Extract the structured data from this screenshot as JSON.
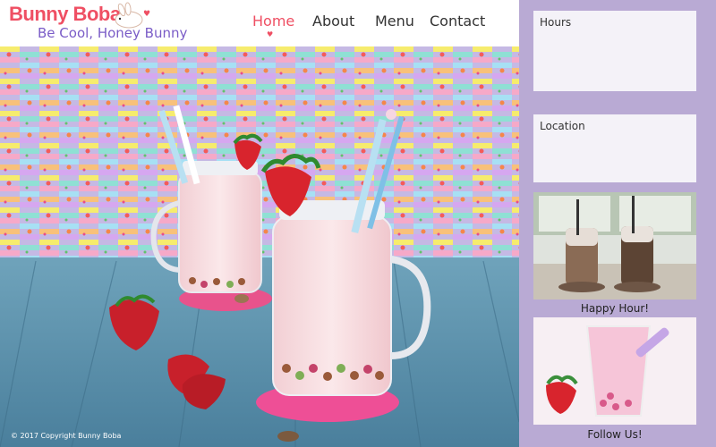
{
  "brand": {
    "name": "Bunny Boba",
    "tagline": "Be Cool, Honey Bunny"
  },
  "nav": {
    "items": [
      {
        "label": "Home",
        "active": true
      },
      {
        "label": "About",
        "active": false
      },
      {
        "label": "Menu",
        "active": false
      },
      {
        "label": "Contact",
        "active": false
      }
    ]
  },
  "footer": {
    "copyright": "© 2017 Copyright Bunny Boba"
  },
  "sidebar": {
    "hours_title": "Hours",
    "location_title": "Location",
    "promo1_caption": "Happy Hour!",
    "promo2_caption": "Follow Us!"
  },
  "colors": {
    "accent": "#ef4f63",
    "tagline": "#7a5cc7",
    "sidebar": "#b9aad4",
    "card": "#f4f2f8"
  }
}
